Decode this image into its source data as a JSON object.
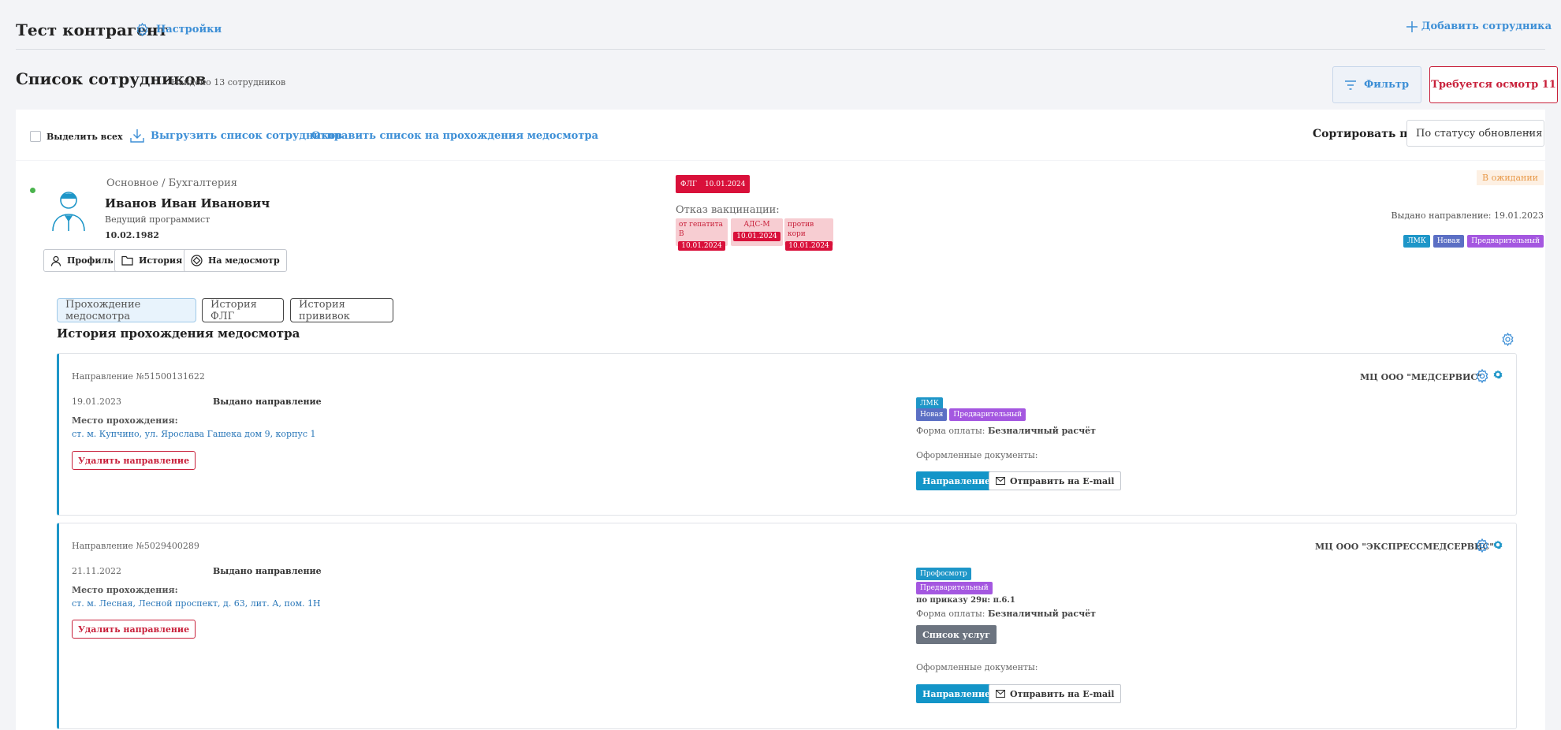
{
  "header": {
    "title": "Тест контрагент",
    "settings_label": "Настройки",
    "add_employee_label": "Добавить сотрудника"
  },
  "list": {
    "title": "Список сотрудников",
    "found": "Найдено 13 сотрудников",
    "filter_label": "Фильтр",
    "need_exam_label": "Требуется осмотр 11"
  },
  "toolbar": {
    "select_all_label": "Выделить всех",
    "export_label": "Выгрузить список сотрудников",
    "send_list_label": "Отправить список на прохождения медосмотра",
    "sort_label": "Сортировать по",
    "sort_value": "По статусу обновления"
  },
  "employee": {
    "department": "Основное / Бухгалтерия",
    "name": "Иванов Иван Иванович",
    "position": "Ведущий программист",
    "dob": "10.02.1982",
    "buttons": {
      "profile": "Профиль",
      "history": "История",
      "to_exam": "На медосмотр"
    },
    "flg": {
      "label": "ФЛГ",
      "date": "10.01.2024"
    },
    "vaccination_refusal_label": "Отказ вакцинации:",
    "vaccinations": [
      {
        "name": "от гепатита В",
        "date": "10.01.2024"
      },
      {
        "name": "АДС-М",
        "date": "10.01.2024"
      },
      {
        "name": "против кори",
        "date": "10.01.2024"
      }
    ],
    "status": "В ожидании",
    "issued": "Выдано направление: 19.01.2023",
    "tags": [
      "ЛМК",
      "Новая",
      "Предварительный"
    ]
  },
  "tabs": [
    "Прохождение медосмотра",
    "История ФЛГ",
    "История прививок"
  ],
  "history_title": "История прохождения медосмотра",
  "directions": [
    {
      "number": "Направление №51500131622",
      "date": "19.01.2023",
      "status": "Выдано направление",
      "place_label": "Место прохождения:",
      "address": "ст. м. Купчино, ул. Ярослава Гашека дом 9, корпус 1",
      "delete_label": "Удалить направление",
      "clinic": "МЦ ООО \"МЕДСЕРВИС\"",
      "tags_row1": [
        "ЛМК"
      ],
      "tags_row2": [
        "Новая",
        "Предварительный"
      ],
      "payment_label": "Форма оплаты:",
      "payment_value": "Безналичный расчёт",
      "docs_label": "Оформленные документы:",
      "direction_btn": "Направление",
      "email_btn": "Отправить на E-mail"
    },
    {
      "number": "Направление №5029400289",
      "date": "21.11.2022",
      "status": "Выдано направление",
      "place_label": "Место прохождения:",
      "address": "ст. м. Лесная, Лесной проспект, д. 63, лит. А, пом. 1Н",
      "delete_label": "Удалить направление",
      "clinic": "МЦ ООО \"ЭКСПРЕССМЕДСЕРВИС\"",
      "tags_row1": [
        "Профосмотр"
      ],
      "tags_row2": [
        "Предварительный"
      ],
      "order": "по приказу 29н: п.6.1",
      "payment_label": "Форма оплаты:",
      "payment_value": "Безналичный расчёт",
      "services_btn": "Список услуг",
      "docs_label": "Оформленные документы:",
      "direction_btn": "Направление",
      "email_btn": "Отправить на E-mail"
    }
  ],
  "colors": {
    "accent": "#3d8fd6",
    "danger": "#c8203a",
    "tag_blue": "#1e96c8",
    "tag_indigo": "#5b6fc4",
    "tag_purple": "#a457e0"
  }
}
